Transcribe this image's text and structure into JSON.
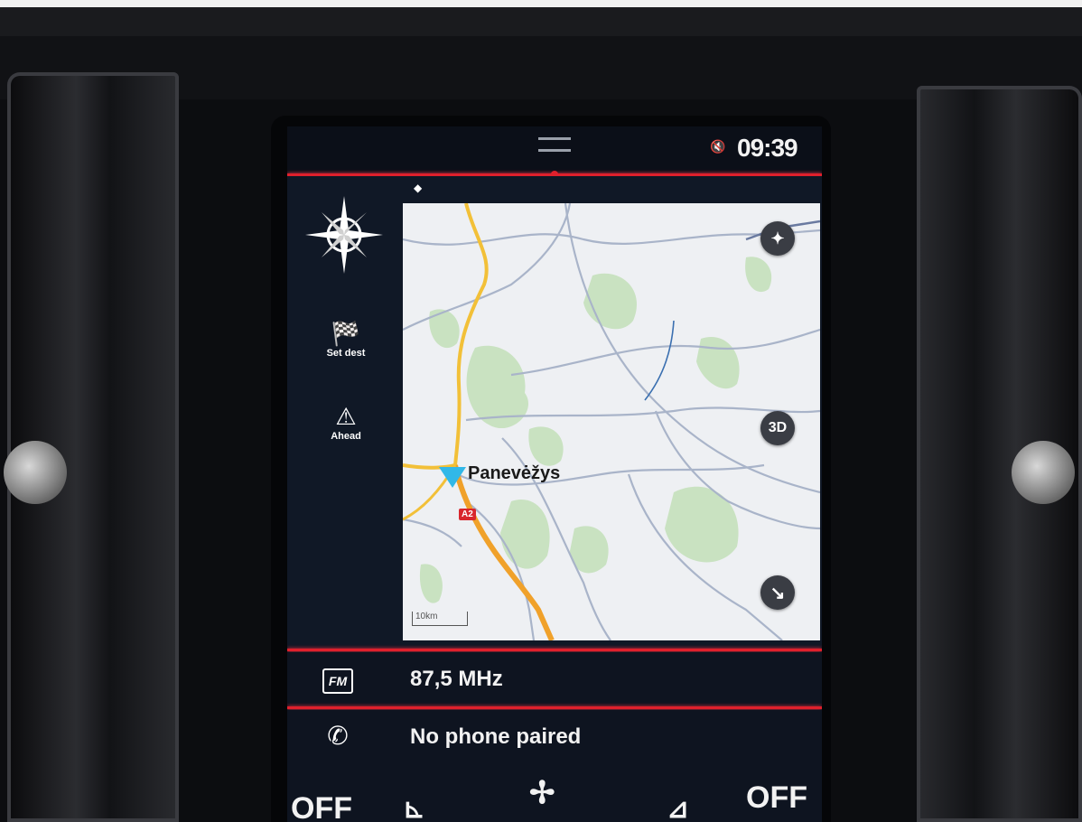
{
  "status_bar": {
    "time": "09:39",
    "mute_icon": "mute-icon"
  },
  "nav": {
    "menu": {
      "set_dest_label": "Set dest",
      "ahead_label": "Ahead"
    },
    "map": {
      "city_label": "Panevėžys",
      "route_shield": "A2",
      "view_3d_label": "3D",
      "scale_label": "10km"
    }
  },
  "media": {
    "radio_icon_text": "FM",
    "radio_frequency": "87,5 MHz"
  },
  "phone": {
    "status_text": "No phone paired"
  },
  "climate": {
    "left_label": "OFF",
    "right_label": "OFF"
  },
  "colors": {
    "accent_red": "#e0202c",
    "map_background": "#eef0f3",
    "road_major": "#f2c038",
    "road_highway": "#f0a12a",
    "forest": "#c9e2c1",
    "vehicle_marker": "#31b8e8"
  }
}
